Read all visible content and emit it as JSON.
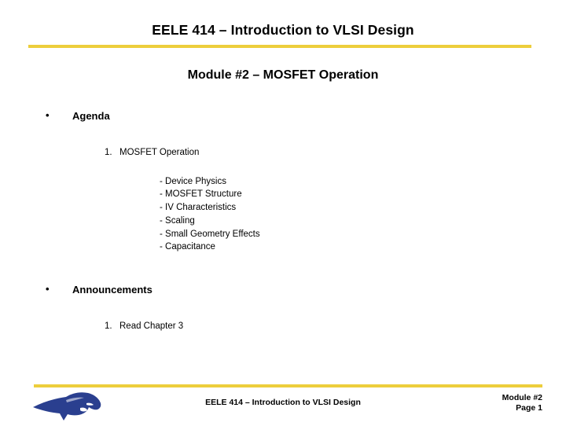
{
  "slide": {
    "title": "EELE 414 – Introduction to VLSI Design",
    "subtitle": "Module #2 – MOSFET Operation",
    "accent_color": "#edce3c",
    "logo_color": "#2a3f8f",
    "sections": [
      {
        "bullet": "•",
        "heading": "Agenda",
        "items": [
          {
            "number": "1.",
            "label": "MOSFET Operation",
            "subitems": [
              "- Device Physics",
              "- MOSFET Structure",
              "- IV Characteristics",
              "- Scaling",
              "- Small Geometry Effects",
              "- Capacitance"
            ]
          }
        ]
      },
      {
        "bullet": "•",
        "heading": "Announcements",
        "items": [
          {
            "number": "1.",
            "label": "Read Chapter 3",
            "subitems": []
          }
        ]
      }
    ]
  },
  "footer": {
    "logo_name": "msu-bobcat-logo",
    "center_text": "EELE 414 – Introduction to VLSI Design",
    "module_label": "Module #2",
    "page_label": "Page 1"
  }
}
